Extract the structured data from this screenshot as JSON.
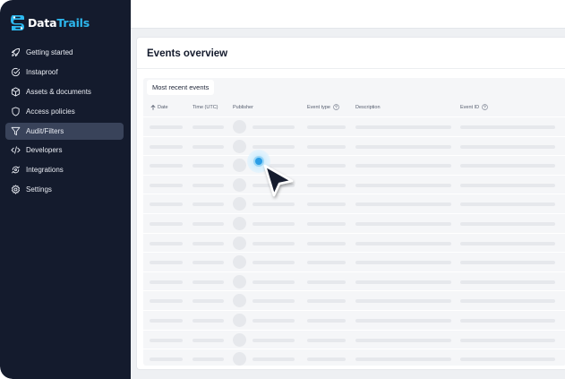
{
  "brand": {
    "name_part1": "Data",
    "name_part2": "Trails",
    "accent": "#2db8ee",
    "sidebar_bg": "#141b2d"
  },
  "sidebar": {
    "items": [
      {
        "label": "Getting started",
        "icon": "rocket-icon",
        "active": false
      },
      {
        "label": "Instaproof",
        "icon": "check-circle-icon",
        "active": false
      },
      {
        "label": "Assets & documents",
        "icon": "cube-icon",
        "active": false
      },
      {
        "label": "Access policies",
        "icon": "shield-icon",
        "active": false
      },
      {
        "label": "Audit/Filters",
        "icon": "filter-icon",
        "active": true
      },
      {
        "label": "Developers",
        "icon": "code-icon",
        "active": false
      },
      {
        "label": "Integrations",
        "icon": "integration-icon",
        "active": false
      },
      {
        "label": "Settings",
        "icon": "gear-icon",
        "active": false
      }
    ]
  },
  "main": {
    "title": "Events overview",
    "tab": "Most recent events",
    "columns": {
      "date": "Date",
      "time": "Time (UTC)",
      "publisher": "Publisher",
      "event_type": "Event type",
      "description": "Description",
      "event_id": "Event ID"
    }
  }
}
